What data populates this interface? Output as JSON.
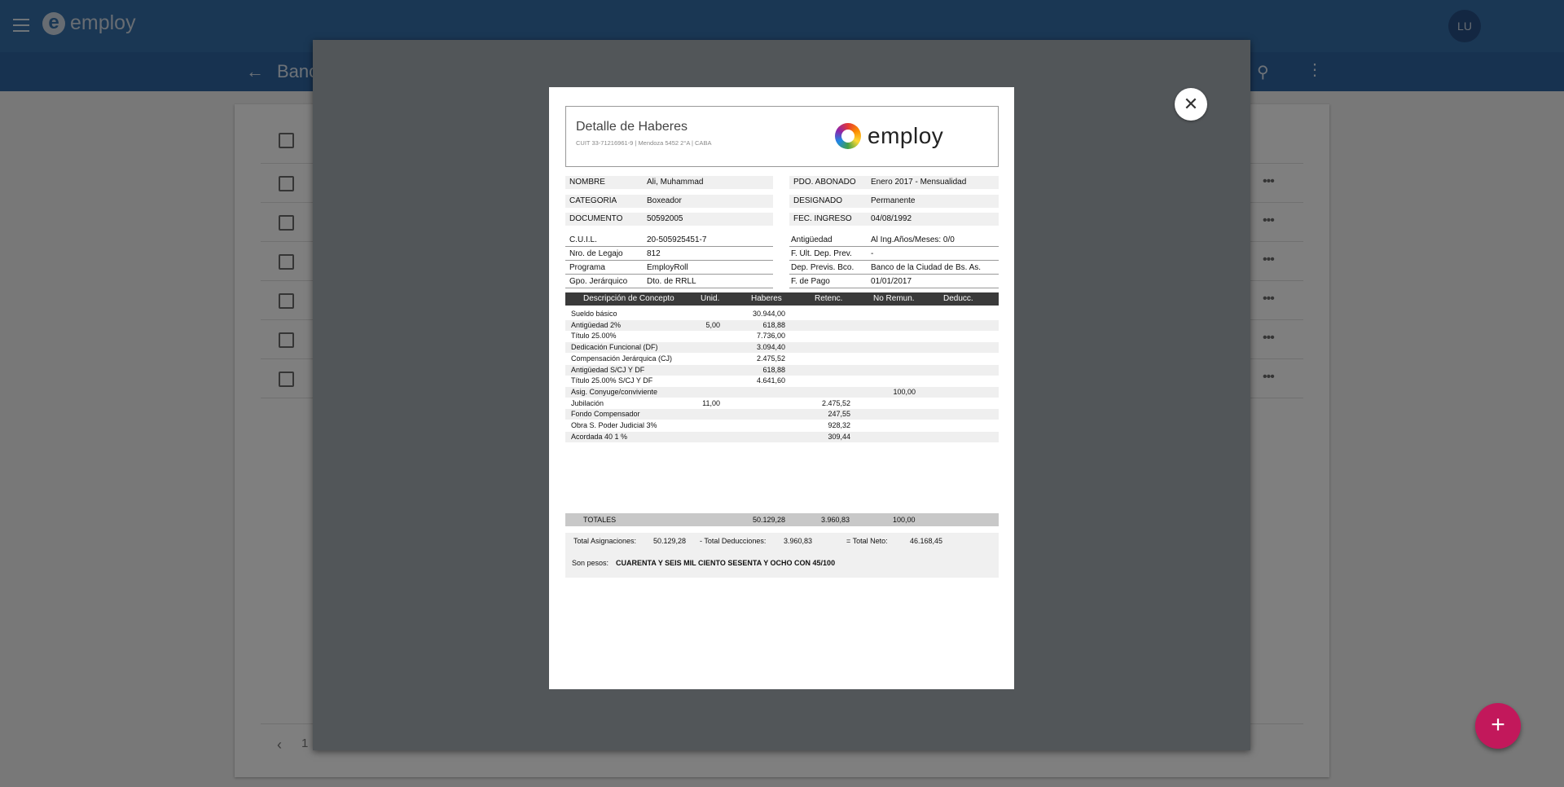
{
  "app": {
    "brand": "employ",
    "avatar_initials": "LU",
    "page_title": "Banc",
    "pager_page": "1"
  },
  "modal": {
    "close_icon": "close-icon"
  },
  "doc": {
    "title": "Detalle de Haberes",
    "subtitle": "CUIT 33-71216961-9 | Mendoza 5452 2°A | CABA",
    "logo_text": "employ",
    "fields": {
      "nombre_label": "NOMBRE",
      "nombre": "Ali, Muhammad",
      "categoria_label": "CATEGORÍA",
      "categoria": "Boxeador",
      "documento_label": "DOCUMENTO",
      "documento": "50592005",
      "pdo_label": "PDO. ABONADO",
      "pdo": "Enero 2017 - Mensualidad",
      "designado_label": "DESIGNADO",
      "designado": "Permanente",
      "ingreso_label": "FEC. INGRESO",
      "ingreso": "04/08/1992",
      "cuil_label": "C.U.I.L.",
      "cuil": "20-505925451-7",
      "legajo_label": "Nro. de Legajo",
      "legajo": "812",
      "programa_label": "Programa",
      "programa": "EmployRoll",
      "gpo_label": "Gpo. Jerárquico",
      "gpo": "Dto. de RRLL",
      "antig_label": "Antigüedad",
      "antig": "Al Ing.Años/Meses: 0/0",
      "fult_label": "F. Últ. Dep. Prev.",
      "fult": "-",
      "dep_label": "Dep. Previs. Bco.",
      "dep": "Banco de la Ciudad de Bs. As.",
      "fpago_label": "F. de Pago",
      "fpago": "01/01/2017"
    },
    "table_headers": [
      "Descripción de Concepto",
      "Unid.",
      "Haberes",
      "Retenc.",
      "No Remun.",
      "Deducc."
    ],
    "rows": [
      {
        "c": "Sueldo básico",
        "u": "",
        "h": "30.944,00",
        "r": "",
        "n": "",
        "d": ""
      },
      {
        "c": "Antigüedad 2%",
        "u": "5,00",
        "h": "618,88",
        "r": "",
        "n": "",
        "d": ""
      },
      {
        "c": "Título 25.00%",
        "u": "",
        "h": "7.736,00",
        "r": "",
        "n": "",
        "d": ""
      },
      {
        "c": "Dedicación Funcional (DF)",
        "u": "",
        "h": "3.094,40",
        "r": "",
        "n": "",
        "d": ""
      },
      {
        "c": "Compensación Jerárquica (CJ)",
        "u": "",
        "h": "2.475,52",
        "r": "",
        "n": "",
        "d": ""
      },
      {
        "c": "Antigüedad S/CJ Y DF",
        "u": "",
        "h": "618,88",
        "r": "",
        "n": "",
        "d": ""
      },
      {
        "c": "Título 25.00% S/CJ Y DF",
        "u": "",
        "h": "4.641,60",
        "r": "",
        "n": "",
        "d": ""
      },
      {
        "c": "Asig. Conyuge/conviviente",
        "u": "",
        "h": "",
        "r": "",
        "n": "100,00",
        "d": ""
      },
      {
        "c": "Jubilación",
        "u": "11,00",
        "h": "",
        "r": "2.475,52",
        "n": "",
        "d": ""
      },
      {
        "c": "Fondo Compensador",
        "u": "",
        "h": "",
        "r": "247,55",
        "n": "",
        "d": ""
      },
      {
        "c": "Obra S. Poder Judicial 3%",
        "u": "",
        "h": "",
        "r": "928,32",
        "n": "",
        "d": ""
      },
      {
        "c": "Acordada 40 1 %",
        "u": "",
        "h": "",
        "r": "309,44",
        "n": "",
        "d": ""
      }
    ],
    "totals": {
      "label": "TOTALES",
      "haberes": "50.129,28",
      "retenc": "3.960,83",
      "noremun": "100,00"
    },
    "summary": {
      "asig_label": "Total Asignaciones:",
      "asig": "50.129,28",
      "deduc_label": "- Total Deducciones:",
      "deduc": "3.960,83",
      "neto_label": "=  Total Neto:",
      "neto": "46.168,45",
      "pesos_label": "Son pesos:",
      "pesos": "CUARENTA Y SEIS MIL CIENTO SESENTA Y OCHO CON 45/100"
    }
  }
}
